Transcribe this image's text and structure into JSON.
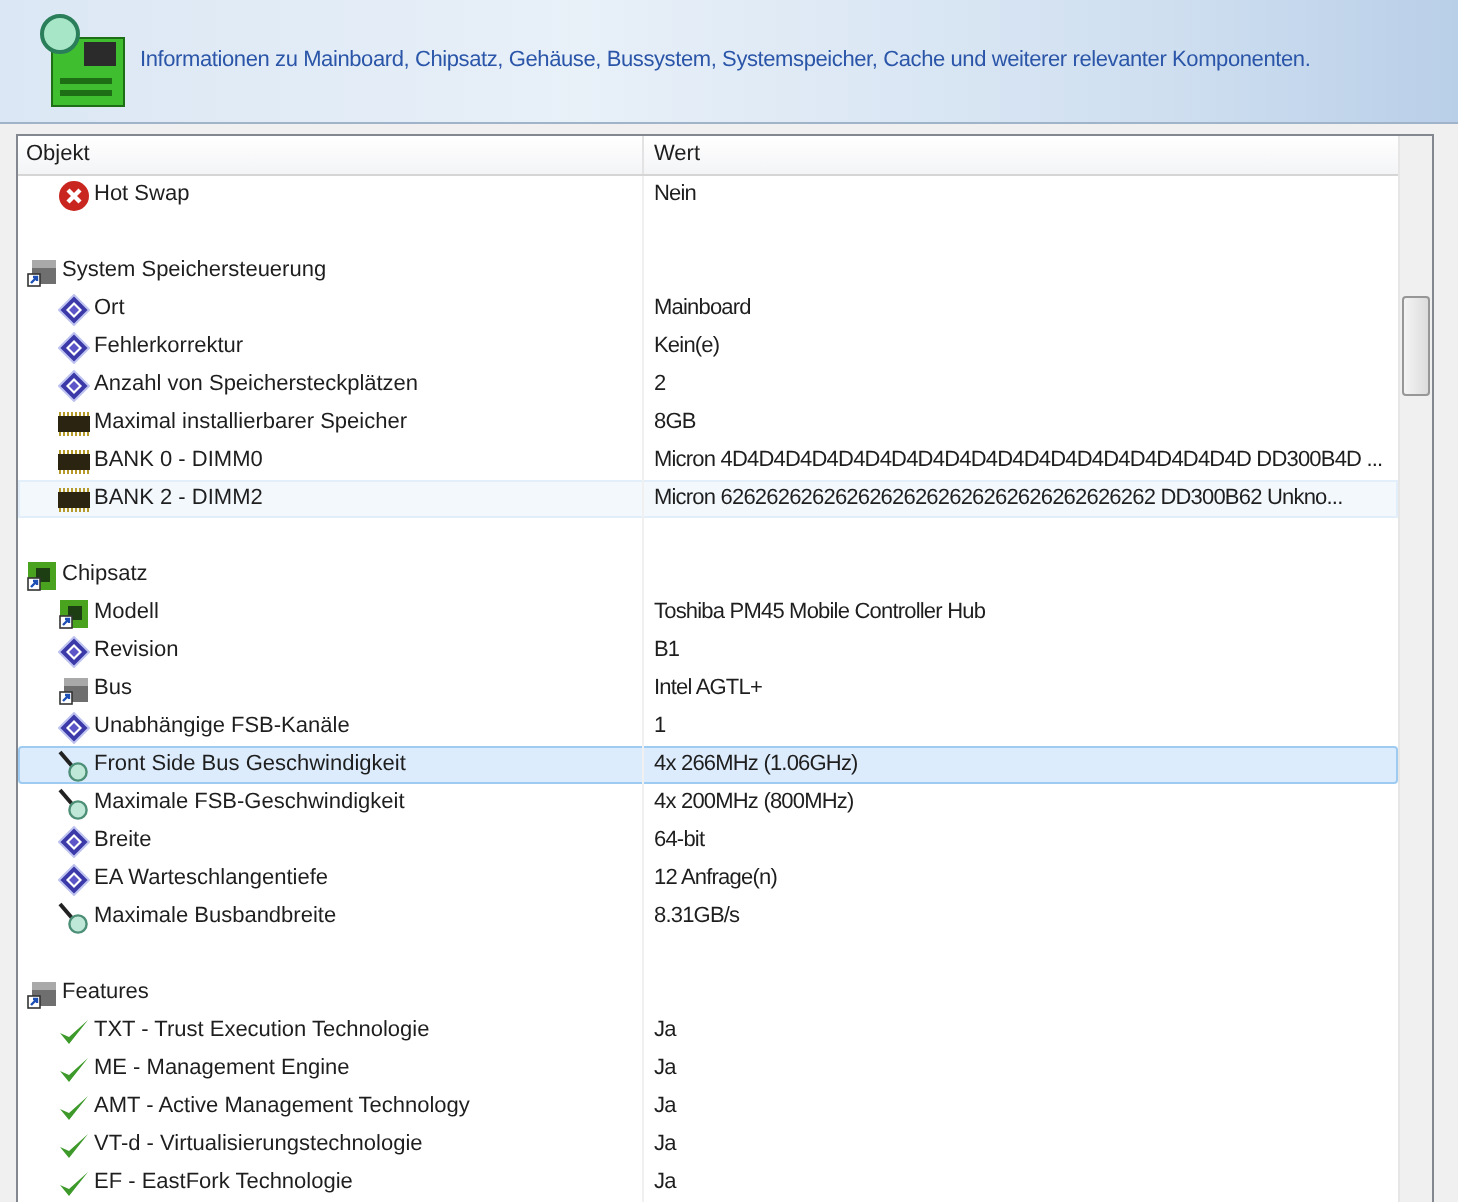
{
  "header": {
    "description": "Informationen zu Mainboard, Chipsatz, Gehäuse, Bussystem, Systemspeicher, Cache und weiterer relevanter Komponenten."
  },
  "table": {
    "columns": [
      "Objekt",
      "Wert"
    ],
    "sections": [
      {
        "items": [
          {
            "kind": "error",
            "label": "Hot Swap",
            "value": "Nein",
            "selected": false,
            "hovered": false
          }
        ]
      },
      {
        "title": "System Speichersteuerung",
        "kind": "group",
        "items": [
          {
            "kind": "info",
            "label": "Ort",
            "value": "Mainboard",
            "selected": false,
            "hovered": false
          },
          {
            "kind": "info",
            "label": "Fehlerkorrektur",
            "value": "Kein(e)",
            "selected": false,
            "hovered": false
          },
          {
            "kind": "info",
            "label": "Anzahl von Speichersteckplätzen",
            "value": "2",
            "selected": false,
            "hovered": false
          },
          {
            "kind": "memory",
            "label": "Maximal installierbarer Speicher",
            "value": "8GB",
            "selected": false,
            "hovered": false
          },
          {
            "kind": "memory",
            "label": "BANK 0 - DIMM0",
            "value": "Micron 4D4D4D4D4D4D4D4D4D4D4D4D4D4D4D4D4D4D4D4D DD300B4D ...",
            "selected": false,
            "hovered": false
          },
          {
            "kind": "memory",
            "label": "BANK 2 - DIMM2",
            "value": "Micron 62626262626262626262626262626262626262 DD300B62 Unkno...",
            "selected": false,
            "hovered": true
          }
        ]
      },
      {
        "title": "Chipsatz",
        "kind": "chip",
        "items": [
          {
            "kind": "chip",
            "label": "Modell",
            "value": "Toshiba PM45 Mobile Controller Hub",
            "selected": false,
            "hovered": false
          },
          {
            "kind": "info",
            "label": "Revision",
            "value": "B1",
            "selected": false,
            "hovered": false
          },
          {
            "kind": "group",
            "label": "Bus",
            "value": "Intel AGTL+",
            "selected": false,
            "hovered": false
          },
          {
            "kind": "info",
            "label": "Unabhängige FSB-Kanäle",
            "value": "1",
            "selected": false,
            "hovered": false
          },
          {
            "kind": "probe",
            "label": "Front Side Bus Geschwindigkeit",
            "value": "4x 266MHz (1.06GHz)",
            "selected": true,
            "hovered": false
          },
          {
            "kind": "probe",
            "label": "Maximale FSB-Geschwindigkeit",
            "value": "4x 200MHz (800MHz)",
            "selected": false,
            "hovered": false
          },
          {
            "kind": "info",
            "label": "Breite",
            "value": "64-bit",
            "selected": false,
            "hovered": false
          },
          {
            "kind": "info",
            "label": "EA Warteschlangentiefe",
            "value": "12 Anfrage(n)",
            "selected": false,
            "hovered": false
          },
          {
            "kind": "probe",
            "label": "Maximale Busbandbreite",
            "value": "8.31GB/s",
            "selected": false,
            "hovered": false
          }
        ]
      },
      {
        "title": "Features",
        "kind": "group",
        "items": [
          {
            "kind": "check",
            "label": "TXT - Trust Execution Technologie",
            "value": "Ja",
            "selected": false,
            "hovered": false
          },
          {
            "kind": "check",
            "label": "ME - Management Engine",
            "value": "Ja",
            "selected": false,
            "hovered": false
          },
          {
            "kind": "check",
            "label": "AMT - Active Management Technology",
            "value": "Ja",
            "selected": false,
            "hovered": false
          },
          {
            "kind": "check",
            "label": "VT-d - Virtualisierungstechnologie",
            "value": "Ja",
            "selected": false,
            "hovered": false
          },
          {
            "kind": "check",
            "label": "EF - EastFork Technologie",
            "value": "Ja",
            "selected": false,
            "hovered": false
          }
        ]
      }
    ]
  }
}
